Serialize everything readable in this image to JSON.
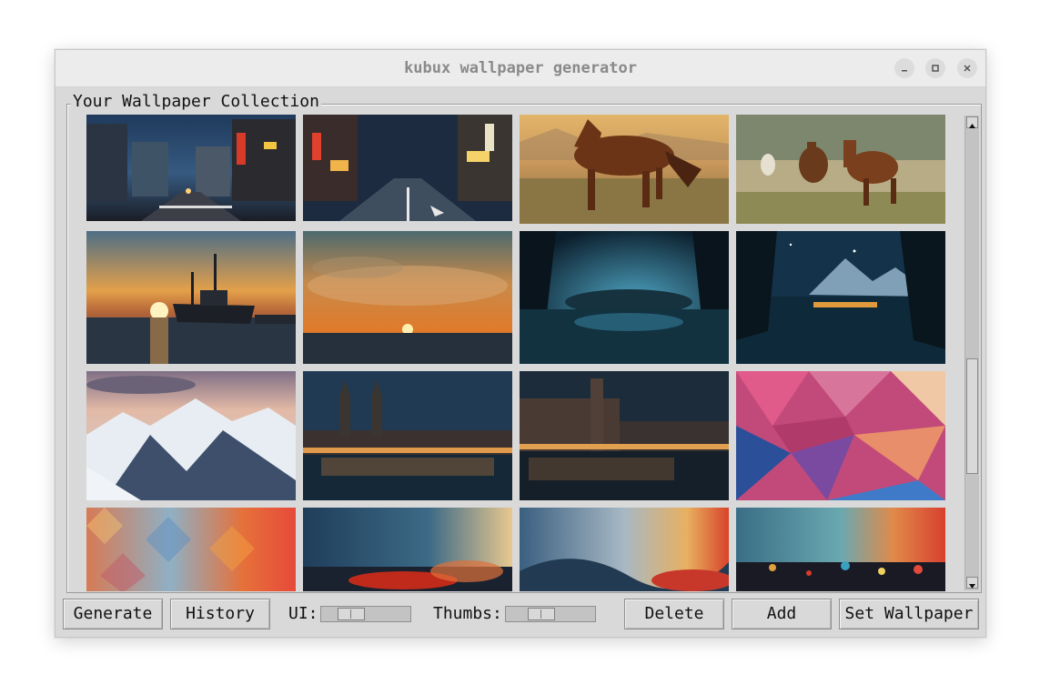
{
  "window": {
    "title": "kubux wallpaper generator"
  },
  "collection": {
    "label": "Your Wallpaper Collection"
  },
  "toolbar": {
    "generate_label": "Generate",
    "history_label": "History",
    "ui_label": "UI:",
    "thumbs_label": "Thumbs:",
    "delete_label": "Delete",
    "add_label": "Add",
    "set_wallpaper_label": "Set Wallpaper"
  },
  "sliders": {
    "ui_level": 0.28,
    "thumbs_level": 0.3
  },
  "scroll": {
    "position": 0.52
  },
  "thumbnails": [
    "city-street-night-1",
    "city-street-night-2",
    "horse-running-sunset",
    "horses-galloping",
    "ship-sunset",
    "cloudy-sunset-sea",
    "night-lake-forest-1",
    "night-lake-mountains",
    "snowy-mountains",
    "cathedral-river-night",
    "canal-city-night",
    "polygon-abstract",
    "geometric-pattern",
    "abstract-paint-blue",
    "abstract-paint-warm",
    "abstract-splatter"
  ]
}
